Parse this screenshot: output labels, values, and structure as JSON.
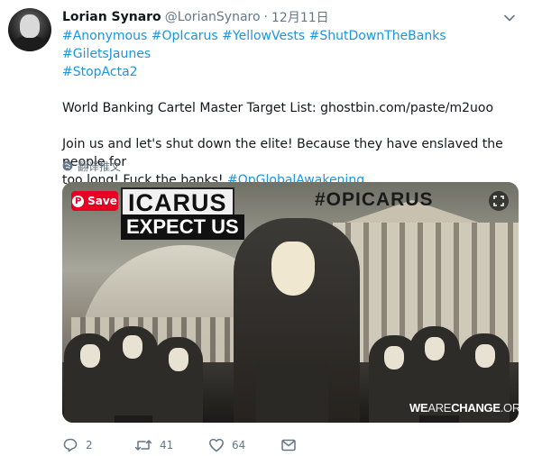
{
  "user": {
    "name": "Lorian Synaro",
    "handle": "@LorianSynaro",
    "separator": "·",
    "time": "12月11日"
  },
  "tweet": {
    "line1": [
      {
        "text": "#Anonymous",
        "hashtag": true
      },
      {
        "text": " ",
        "hashtag": false
      },
      {
        "text": "#OpIcarus",
        "hashtag": true
      },
      {
        "text": " ",
        "hashtag": false
      },
      {
        "text": "#YellowVests",
        "hashtag": true
      },
      {
        "text": " ",
        "hashtag": false
      },
      {
        "text": "#ShutDownTheBanks",
        "hashtag": true
      },
      {
        "text": " ",
        "hashtag": false
      },
      {
        "text": "#GiletsJaunes",
        "hashtag": true
      }
    ],
    "line2": "#StopActa2",
    "para2_prefix": "World Banking Cartel Master Target List: ",
    "para2_link": "ghostbin.com/paste/m2uoo",
    "para3_line1": "Join us and let's shut down the elite! Because they have enslaved the people for",
    "para3_line2_text": "too long! Fuck the banks! ",
    "para3_line2_tag": "#OpGlobalAwakening"
  },
  "translate_label": "翻译推文",
  "media": {
    "save_label": "Save",
    "pin_glyph": "P",
    "icarus_text": "ICARUS",
    "expect_text": "EXPECT US",
    "opicarus_text": "#OPICARUS",
    "wearechange_bold1": "WE",
    "wearechange_dim": "ARE",
    "wearechange_bold2": "CHANGE",
    "wearechange_suffix": ".ORG"
  },
  "actions": {
    "reply_count": "2",
    "retweet_count": "41",
    "like_count": "64"
  },
  "icons": {
    "avatar": "avatar",
    "menu": "chevron-down-icon",
    "translate": "globe-icon",
    "reply": "reply-icon",
    "retweet": "retweet-icon",
    "like": "heart-icon",
    "dm": "envelope-icon",
    "expand": "expand-icon"
  },
  "colors": {
    "link": "#1b95e0",
    "muted": "#657786",
    "text": "#14171a",
    "pinterest": "#e60023"
  }
}
